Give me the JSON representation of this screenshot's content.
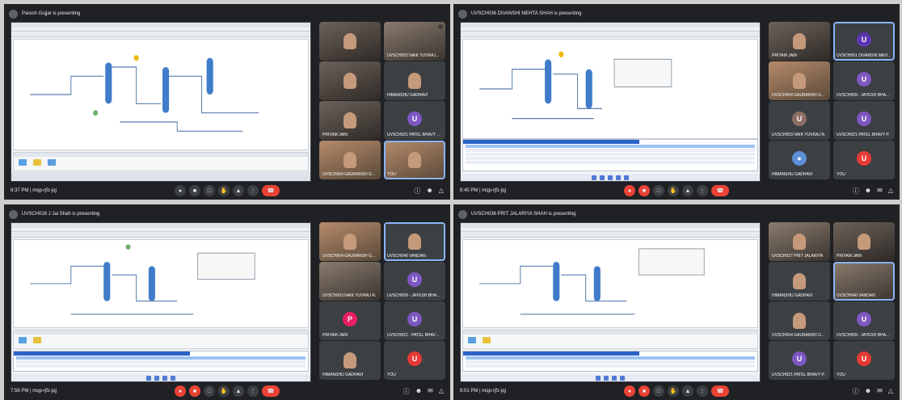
{
  "panels": [
    {
      "presenter": "Paresh Gujjar is presenting",
      "meeting_time": "8:37 PM",
      "meeting_code": "mqp-rjfz-jqj",
      "controls_state": "mic-off",
      "participants": [
        {
          "name": "",
          "type": "camera"
        },
        {
          "name": "UVSCH003 NAIK YUVRAJ...",
          "type": "camera"
        },
        {
          "name": "",
          "type": "camera"
        },
        {
          "name": "HIMANSHU Gadhavi",
          "type": "camera"
        },
        {
          "name": "Priyam Jain",
          "type": "camera"
        },
        {
          "name": "UVSCH021 PATEL BHAVY P...",
          "type": "avatar",
          "initial": "U",
          "color": "#7e57c2"
        },
        {
          "name": "UVSCH004 GAURANSH GUPTA",
          "type": "camera"
        },
        {
          "name": "You",
          "type": "camera",
          "active": true
        }
      ]
    },
    {
      "presenter": "UVSCH036 DIVANSHI MEHTA SHAH is presenting",
      "meeting_time": "8:40 PM",
      "meeting_code": "mqp-rjfz-jqj",
      "controls_state": "mic-off",
      "participants": [
        {
          "name": "Priyam Jain",
          "type": "camera"
        },
        {
          "name": "UVSCH001 DIVANSHI MEHTA",
          "type": "avatar",
          "initial": "U",
          "color": "#5e35b1",
          "active": true
        },
        {
          "name": "UVSCH004 GAURANSH GUPTA",
          "type": "camera"
        },
        {
          "name": "UVSCH009 - JAYESH BHAGAT",
          "type": "avatar",
          "initial": "U",
          "color": "#7e57c2"
        },
        {
          "name": "UVSCH003 NAIK YUVRAJ R.",
          "type": "avatar",
          "initial": "U",
          "color": "#8d6e63"
        },
        {
          "name": "UVSCH021 PATEL BHAVY P.",
          "type": "avatar",
          "initial": "U",
          "color": "#7e57c2"
        },
        {
          "name": "HIMANSHU Gadhavi",
          "type": "camera"
        },
        {
          "name": "You",
          "type": "avatar",
          "initial": "U",
          "color": "#e53935"
        }
      ]
    },
    {
      "presenter": "UVSCH016 J Jai Shah is presenting",
      "meeting_time": "7:56 PM",
      "meeting_code": "mqp-rjfz-jqj",
      "controls_state": "mic-off",
      "participants": [
        {
          "name": "UVSCH004 GAURANSH GUPTA",
          "type": "camera"
        },
        {
          "name": "UVSCH040 Vandan",
          "type": "camera",
          "active": true
        },
        {
          "name": "UVSCH003 NAIK YUVRAJ R.",
          "type": "camera"
        },
        {
          "name": "UVSCH009 - JAYESH BHAGAT",
          "type": "avatar",
          "initial": "U",
          "color": "#7e57c2"
        },
        {
          "name": "Priyam Jain",
          "type": "avatar",
          "initial": "P",
          "color": "#e91e63"
        },
        {
          "name": "UVSCH021 - PATEL BHAVY P.",
          "type": "avatar",
          "initial": "U",
          "color": "#7e57c2"
        },
        {
          "name": "HIMANSHU Gadhavi",
          "type": "camera"
        },
        {
          "name": "You",
          "type": "avatar",
          "initial": "U",
          "color": "#e53935"
        }
      ]
    },
    {
      "presenter": "UVSCH036 PRIT JALARIYA SHAH is presenting",
      "meeting_time": "8:01 PM",
      "meeting_code": "mqp-rjfz-jqj",
      "controls_state": "mic-off",
      "participants": [
        {
          "name": "UVSCH027 PRIT JALARIYA",
          "type": "camera"
        },
        {
          "name": "Priyam Jain",
          "type": "camera"
        },
        {
          "name": "HIMANSHU Gadhavi",
          "type": "camera"
        },
        {
          "name": "UVSCH040 Vandan",
          "type": "camera",
          "active": true
        },
        {
          "name": "UVSCH004 GAURANSH GUPTA",
          "type": "camera"
        },
        {
          "name": "UVSCH009 - JAYESH BHAGAT",
          "type": "avatar",
          "initial": "U",
          "color": "#7e57c2"
        },
        {
          "name": "UVSCH021 PATEL BHAVY P.",
          "type": "avatar",
          "initial": "U",
          "color": "#7e57c2"
        },
        {
          "name": "You",
          "type": "avatar",
          "initial": "U",
          "color": "#e53935"
        }
      ]
    }
  ],
  "icons": {
    "presenter": "presentation-icon",
    "mic": "mic-icon",
    "cam": "camera-icon",
    "captions": "captions-icon",
    "hand": "raise-hand-icon",
    "present": "present-screen-icon",
    "more": "more-options-icon",
    "end": "end-call-icon",
    "info": "info-icon",
    "people": "people-icon",
    "chat": "chat-icon",
    "activities": "activities-icon"
  }
}
